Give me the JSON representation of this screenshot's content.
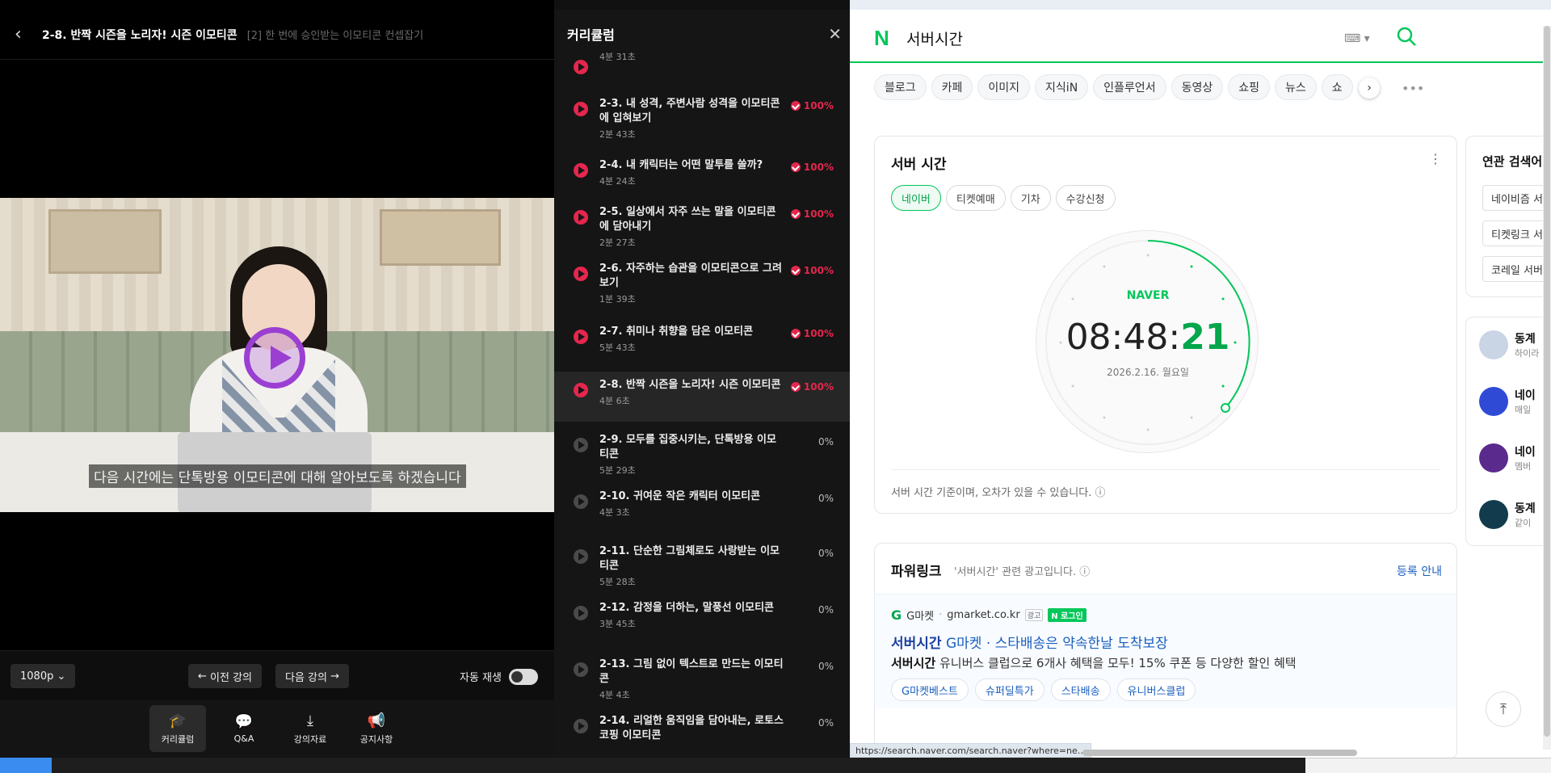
{
  "video": {
    "title": "2-8. 반짝 시즌을 노리자! 시즌 이모티콘",
    "course_subtitle": "[2] 한 번에 승인받는 이모티콘 컨셉잡기",
    "caption": "다음 시간에는 단톡방용 이모티콘에 대해 알아보도록 하겠습니다",
    "quality": "1080p",
    "prev_label": "이전 강의",
    "next_label": "다음 강의",
    "autoplay_label": "자동 재생",
    "autoplay_on": false,
    "tabs": [
      {
        "label": "커리큘럼",
        "icon": "graduation-cap-icon",
        "active": true
      },
      {
        "label": "Q&A",
        "icon": "chat-bubble-icon",
        "active": false
      },
      {
        "label": "강의자료",
        "icon": "download-icon",
        "active": false
      },
      {
        "label": "공지사항",
        "icon": "megaphone-icon",
        "active": false
      }
    ]
  },
  "curriculum": {
    "title": "커리큘럼",
    "items": [
      {
        "title": "",
        "duration": "4분 31초",
        "progress": "",
        "status": "done"
      },
      {
        "title": "2-3. 내 성격, 주변사람 성격을 이모티콘에 입혀보기",
        "duration": "2분 43초",
        "progress": "100%",
        "status": "done"
      },
      {
        "title": "2-4. 내 캐릭터는 어떤 말투를 쓸까?",
        "duration": "4분 24초",
        "progress": "100%",
        "status": "done"
      },
      {
        "title": "2-5. 일상에서 자주 쓰는 말을 이모티콘에 담아내기",
        "duration": "2분 27초",
        "progress": "100%",
        "status": "done"
      },
      {
        "title": "2-6. 자주하는 습관을 이모티콘으로 그려보기",
        "duration": "1분 39초",
        "progress": "100%",
        "status": "done"
      },
      {
        "title": "2-7. 취미나 취향을 담은 이모티콘",
        "duration": "5분 43초",
        "progress": "100%",
        "status": "done"
      },
      {
        "title": "2-8. 반짝 시즌을 노리자! 시즌 이모티콘",
        "duration": "4분 6초",
        "progress": "100%",
        "status": "current"
      },
      {
        "title": "2-9. 모두를 집중시키는, 단톡방용 이모티콘",
        "duration": "5분 29초",
        "progress": "0%",
        "status": "todo"
      },
      {
        "title": "2-10. 귀여운 작은 캐릭터 이모티콘",
        "duration": "4분 3초",
        "progress": "0%",
        "status": "todo"
      },
      {
        "title": "2-11. 단순한 그림체로도 사랑받는 이모티콘",
        "duration": "5분 28초",
        "progress": "0%",
        "status": "todo"
      },
      {
        "title": "2-12. 감정을 더하는, 말풍선 이모티콘",
        "duration": "3분 45초",
        "progress": "0%",
        "status": "todo"
      },
      {
        "title": "2-13. 그림 없이 텍스트로 만드는 이모티콘",
        "duration": "4분 4초",
        "progress": "0%",
        "status": "todo"
      },
      {
        "title": "2-14. 리얼한 움직임을 담아내는, 로토스코핑 이모티콘",
        "duration": "",
        "progress": "0%",
        "status": "todo"
      }
    ]
  },
  "naver": {
    "query": "서버시간",
    "tabs": [
      "블로그",
      "카페",
      "이미지",
      "지식iN",
      "인플루언서",
      "동영상",
      "쇼핑",
      "뉴스",
      "쇼"
    ],
    "server_time": {
      "title": "서버 시간",
      "chips": [
        "네이버",
        "티켓예매",
        "기차",
        "수강신청"
      ],
      "brand": "NAVER",
      "time_hm": "08:48:",
      "time_s": "21",
      "date": "2026.2.16. 월요일",
      "note": "서버 시간 기준이며, 오차가 있을 수 있습니다."
    },
    "powerlink": {
      "title": "파워링크",
      "desc": "'서버시간' 관련 광고입니다.",
      "register": "등록 안내",
      "ad": {
        "brand": "G마켓",
        "domain": "gmarket.co.kr",
        "ad_badge": "광고",
        "login_badge": "N 로그인",
        "headline_kw": "서버시간",
        "headline": "G마켓 · 스타배송은 약속한날 도착보장",
        "body_kw": "서버시간",
        "body": "유니버스 클럽으로 6개사 혜택을 모두! 15% 쿠폰 등 다양한 할인 혜택",
        "tags": [
          "G마켓베스트",
          "슈퍼딜특가",
          "스타배송",
          "유니버스클럽"
        ]
      }
    },
    "related": {
      "title": "연관 검색어",
      "items": [
        "네이비즘 서",
        "티켓링크 서",
        "코레일 서버"
      ]
    },
    "side_items": [
      {
        "name": "동계",
        "sub": "하이라"
      },
      {
        "name": "네이",
        "sub": "매일"
      },
      {
        "name": "네이",
        "sub": "멤버"
      },
      {
        "name": "동계",
        "sub": "같이"
      }
    ],
    "status_url": "https://search.naver.com/search.naver?where=ne..."
  }
}
